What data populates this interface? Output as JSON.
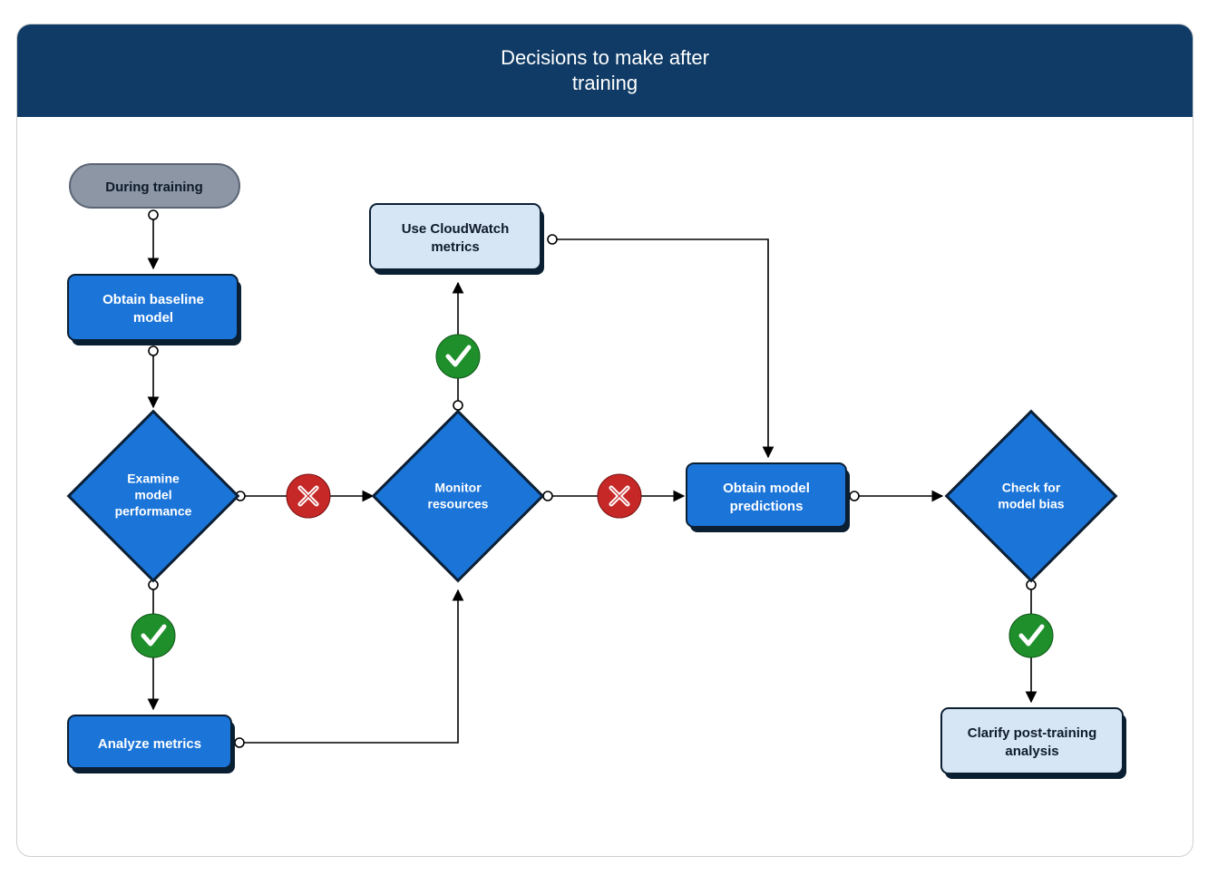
{
  "header": {
    "title_line1": "Decisions to make after",
    "title_line2": "training"
  },
  "nodes": {
    "during_training": {
      "label": "During training"
    },
    "obtain_baseline": {
      "line1": "Obtain baseline",
      "line2": "model"
    },
    "examine_perf": {
      "line1": "Examine",
      "line2": "model",
      "line3": "performance"
    },
    "analyze_metrics": {
      "label": "Analyze metrics"
    },
    "monitor_resources": {
      "line1": "Monitor",
      "line2": "resources"
    },
    "use_cloudwatch": {
      "line1": "Use CloudWatch",
      "line2": "metrics"
    },
    "obtain_predictions": {
      "line1": "Obtain model",
      "line2": "predictions"
    },
    "check_bias": {
      "line1": "Check for",
      "line2": "model bias"
    },
    "clarify_post": {
      "line1": "Clarify post-training",
      "line2": "analysis"
    }
  },
  "colors": {
    "header_bg": "#0f3b66",
    "primary": "#1b74d8",
    "primary_shadow": "#0b1f33",
    "light": "#d6e6f5",
    "grey": "#8c96a4",
    "grey_border": "#5a6473",
    "green": "#1f8f2b",
    "red": "#c62828",
    "stroke": "#111111"
  }
}
